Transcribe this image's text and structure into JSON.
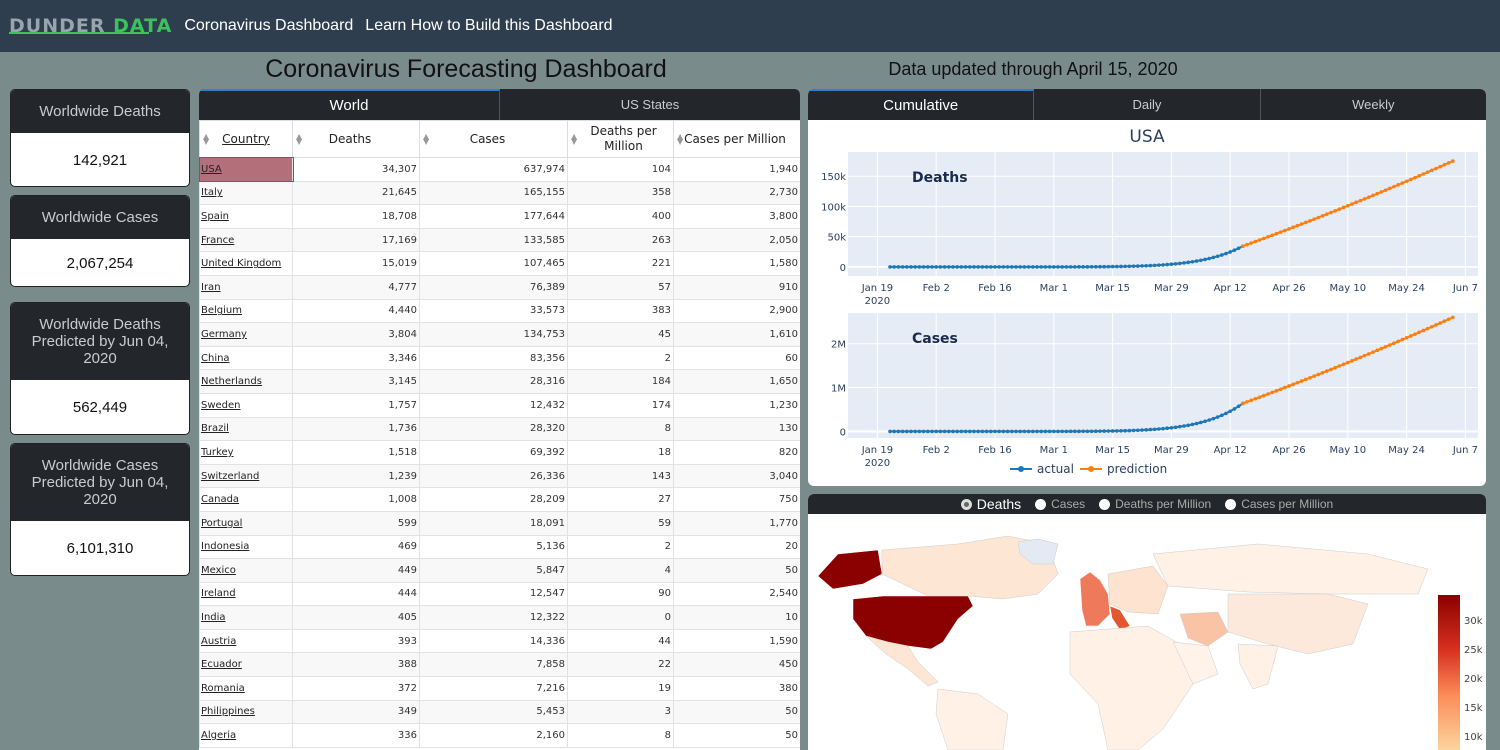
{
  "navbar": {
    "brand_part1": "DUNDER",
    "brand_part2": "DATA",
    "links": [
      "Coronavirus Dashboard",
      "Learn How to Build this Dashboard"
    ]
  },
  "page_title": "Coronavirus Forecasting Dashboard",
  "updated_text": "Data updated through April 15, 2020",
  "cards": [
    {
      "title": "Worldwide Deaths",
      "value": "142,921"
    },
    {
      "title": "Worldwide Cases",
      "value": "2,067,254"
    },
    {
      "title": "Worldwide Deaths Predicted by Jun 04, 2020",
      "value": "562,449"
    },
    {
      "title": "Worldwide Cases Predicted by Jun 04, 2020",
      "value": "6,101,310"
    }
  ],
  "table_tabs": [
    "World",
    "US States"
  ],
  "table": {
    "columns": [
      "Country",
      "Deaths",
      "Cases",
      "Deaths per Million",
      "Cases per Million"
    ],
    "rows": [
      [
        "USA",
        "34,307",
        "637,974",
        "104",
        "1,940"
      ],
      [
        "Italy",
        "21,645",
        "165,155",
        "358",
        "2,730"
      ],
      [
        "Spain",
        "18,708",
        "177,644",
        "400",
        "3,800"
      ],
      [
        "France",
        "17,169",
        "133,585",
        "263",
        "2,050"
      ],
      [
        "United Kingdom",
        "15,019",
        "107,465",
        "221",
        "1,580"
      ],
      [
        "Iran",
        "4,777",
        "76,389",
        "57",
        "910"
      ],
      [
        "Belgium",
        "4,440",
        "33,573",
        "383",
        "2,900"
      ],
      [
        "Germany",
        "3,804",
        "134,753",
        "45",
        "1,610"
      ],
      [
        "China",
        "3,346",
        "83,356",
        "2",
        "60"
      ],
      [
        "Netherlands",
        "3,145",
        "28,316",
        "184",
        "1,650"
      ],
      [
        "Sweden",
        "1,757",
        "12,432",
        "174",
        "1,230"
      ],
      [
        "Brazil",
        "1,736",
        "28,320",
        "8",
        "130"
      ],
      [
        "Turkey",
        "1,518",
        "69,392",
        "18",
        "820"
      ],
      [
        "Switzerland",
        "1,239",
        "26,336",
        "143",
        "3,040"
      ],
      [
        "Canada",
        "1,008",
        "28,209",
        "27",
        "750"
      ],
      [
        "Portugal",
        "599",
        "18,091",
        "59",
        "1,770"
      ],
      [
        "Indonesia",
        "469",
        "5,136",
        "2",
        "20"
      ],
      [
        "Mexico",
        "449",
        "5,847",
        "4",
        "50"
      ],
      [
        "Ireland",
        "444",
        "12,547",
        "90",
        "2,540"
      ],
      [
        "India",
        "405",
        "12,322",
        "0",
        "10"
      ],
      [
        "Austria",
        "393",
        "14,336",
        "44",
        "1,590"
      ],
      [
        "Ecuador",
        "388",
        "7,858",
        "22",
        "450"
      ],
      [
        "Romania",
        "372",
        "7,216",
        "19",
        "380"
      ],
      [
        "Philippines",
        "349",
        "5,453",
        "3",
        "50"
      ],
      [
        "Algeria",
        "336",
        "2,160",
        "8",
        "50"
      ]
    ]
  },
  "chart_tabs": [
    "Cumulative",
    "Daily",
    "Weekly"
  ],
  "chart_data": {
    "type": "line",
    "title": "USA",
    "x_tick_labels": [
      "Jan 19\n2020",
      "Feb 2",
      "Feb 16",
      "Mar 1",
      "Mar 15",
      "Mar 29",
      "Apr 12",
      "Apr 26",
      "May 10",
      "May 24",
      "Jun 7"
    ],
    "x_range": [
      "2020-01-12",
      "2020-06-10"
    ],
    "legend": [
      "actual",
      "prediction"
    ],
    "legend_position": "bottom",
    "colors": {
      "actual": "#1f77b4",
      "prediction": "#ff7f0e"
    },
    "panels": [
      {
        "label": "Deaths",
        "y_ticks": [
          "0",
          "50k",
          "100k",
          "150k"
        ],
        "y_tick_values": [
          0,
          50000,
          100000,
          150000
        ],
        "ylim": [
          -15000,
          190000
        ],
        "actual_end_date": "2020-04-15",
        "actual_end_value": 34307,
        "prediction_end_date": "2020-06-04",
        "prediction_end_value": 175000
      },
      {
        "label": "Cases",
        "y_ticks": [
          "0",
          "1M",
          "2M"
        ],
        "y_tick_values": [
          0,
          1000000,
          2000000
        ],
        "ylim": [
          -150000,
          2700000
        ],
        "actual_end_date": "2020-04-15",
        "actual_end_value": 637974,
        "prediction_end_date": "2020-06-04",
        "prediction_end_value": 2600000
      }
    ]
  },
  "map_options": [
    "Deaths",
    "Cases",
    "Deaths per Million",
    "Cases per Million"
  ],
  "map_selected": "Deaths",
  "colorbar_ticks": [
    "30k",
    "25k",
    "20k",
    "15k",
    "10k"
  ]
}
